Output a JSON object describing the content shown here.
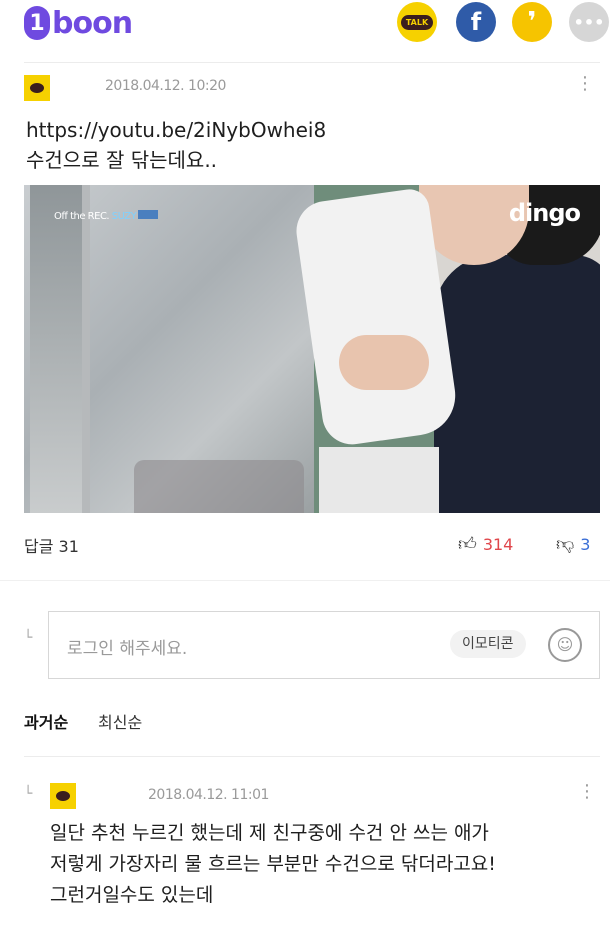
{
  "header": {
    "logo": "1boon",
    "share_buttons": [
      {
        "name": "kakaotalk",
        "label": "TALK"
      },
      {
        "name": "facebook",
        "label": "f"
      },
      {
        "name": "kakaostory",
        "label": "❜"
      },
      {
        "name": "more",
        "label": "•••"
      }
    ]
  },
  "post": {
    "timestamp": "2018.04.12. 10:20",
    "text": "https://youtu.be/2iNybOwhei8\n수건으로 잘 닦는데요..",
    "video": {
      "overlay_badge": "Off the REC.",
      "overlay_badge_highlight": "SUZY",
      "brand_watermark": "dingo"
    },
    "reply_count": "답글 31",
    "likes": "314",
    "dislikes": "3"
  },
  "comment_input": {
    "placeholder": "로그인 해주세요.",
    "emoticon_button": "이모티콘"
  },
  "sort_tabs": [
    {
      "label": "과거순",
      "active": true
    },
    {
      "label": "최신순",
      "active": false
    }
  ],
  "replies": [
    {
      "timestamp": "2018.04.12. 11:01",
      "text": "일단 추천 누르긴 했는데 제 친구중에 수건 안 쓰는 애가\n저렇게 가장자리 물 흐르는 부분만 수건으로 닦더라고요!\n그런거일수도 있는데"
    }
  ],
  "colors": {
    "brand": "#6f4ae0",
    "kakao_yellow": "#f6d100",
    "facebook_blue": "#2f5ba8",
    "like_red": "#e0464b",
    "dislike_blue": "#3b6fd6"
  }
}
